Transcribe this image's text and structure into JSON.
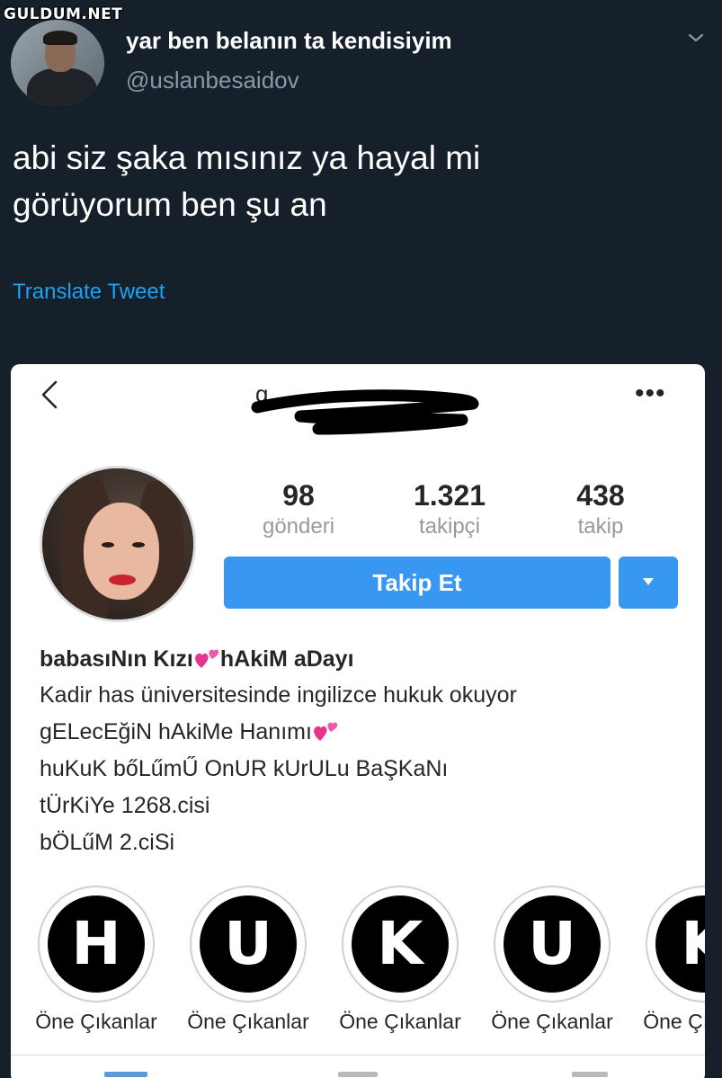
{
  "watermark": "GULDUM.NET",
  "tweet": {
    "display_name": "yar ben belanın ta kendisiyim",
    "handle": "@uslanbesaidov",
    "text_line1": "abi siz şaka mısınız ya hayal mi",
    "text_line2": "görüyorum ben şu an",
    "translate_label": "Translate Tweet",
    "icons": {
      "more": "chevron-down-icon"
    }
  },
  "instagram": {
    "header": {
      "username_visible": "g",
      "icons": {
        "back": "back-chevron-icon",
        "more": "more-dots-icon"
      },
      "more_label": "•••"
    },
    "stats": {
      "posts": {
        "value": "98",
        "label": "gönderi"
      },
      "followers": {
        "value": "1.321",
        "label": "takipçi"
      },
      "following": {
        "value": "438",
        "label": "takip"
      }
    },
    "follow_button": "Takip Et",
    "bio": {
      "name_part1": "babasıNın Kızı",
      "name_part2": "hAkiM aDayı",
      "line1": "Kadir has üniversitesinde ingilizce hukuk okuyor",
      "line2": "gELecEğiN hAkiMe Hanımı",
      "line3": "huKuK bőLűmŰ OnUR kUrULu BaŞKaNı",
      "line4": "tÜrKiYe 1268.cisi",
      "line5": "bÖLűM 2.ciSi"
    },
    "highlights": [
      {
        "letter": "H",
        "caption": "Öne Çıkanlar"
      },
      {
        "letter": "U",
        "caption": "Öne Çıkanlar"
      },
      {
        "letter": "K",
        "caption": "Öne Çıkanlar"
      },
      {
        "letter": "U",
        "caption": "Öne Çıkanlar"
      },
      {
        "letter": "K",
        "caption": "Öne Çıkanlar"
      }
    ],
    "colors": {
      "primary_button": "#3897f0",
      "heart": "#e8348f"
    }
  },
  "colors": {
    "twitter_bg": "#15202b",
    "link": "#1da1f2",
    "handle": "#8899a6"
  }
}
